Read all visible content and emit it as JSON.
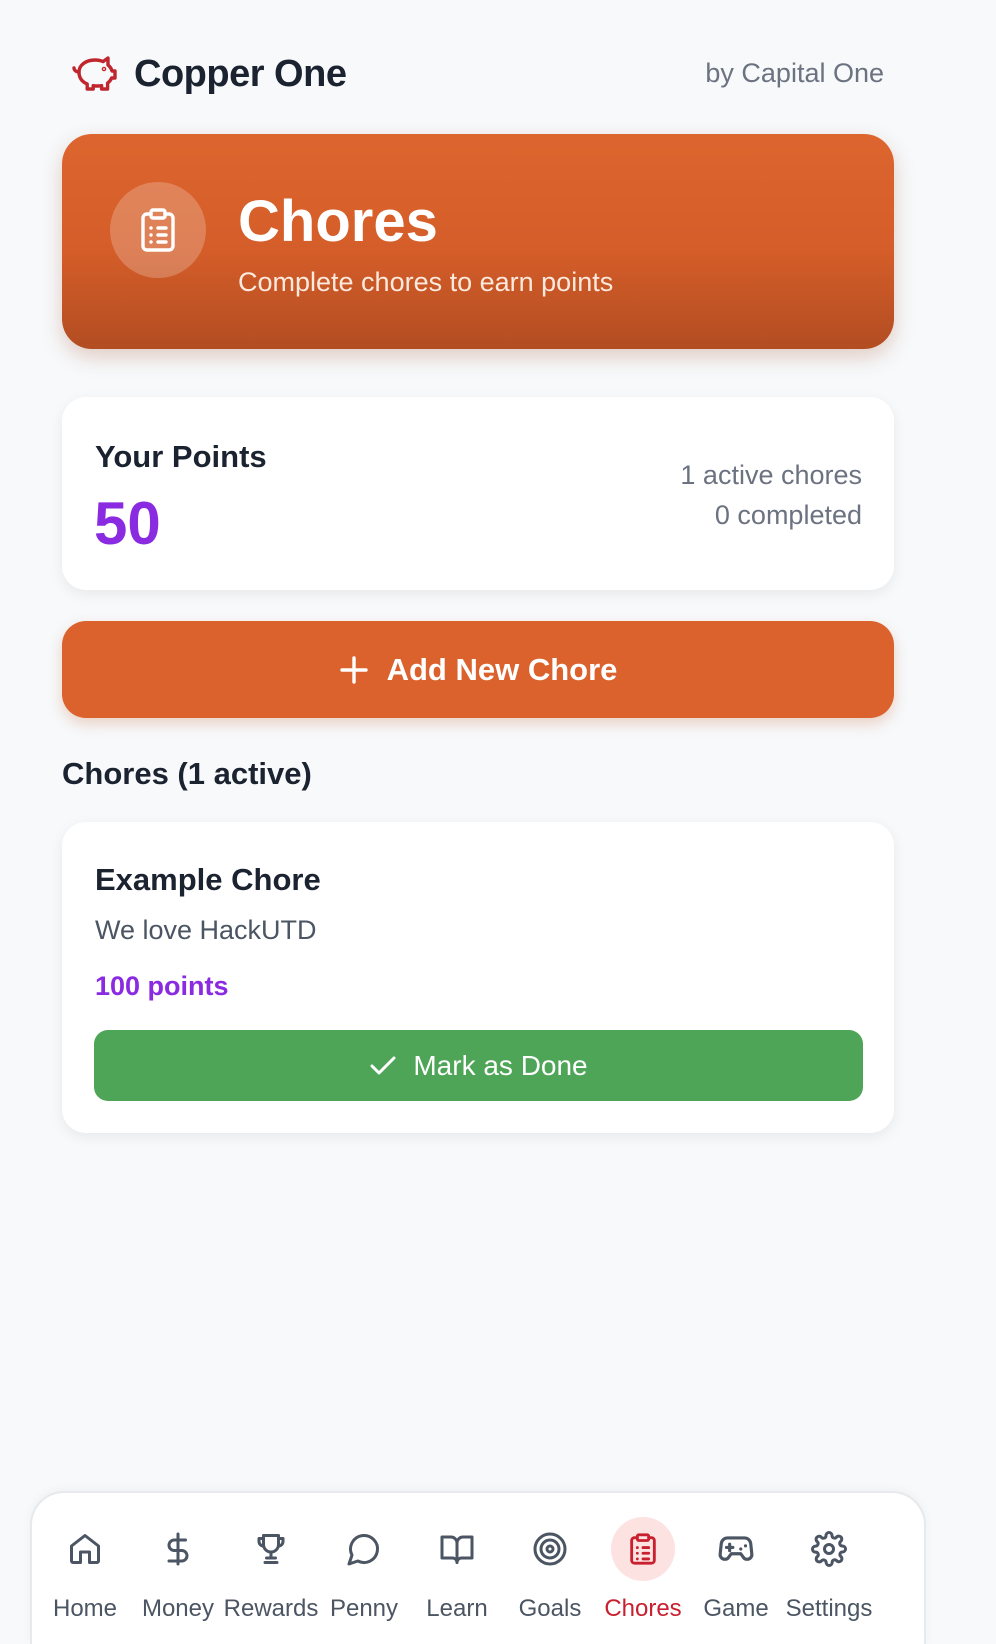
{
  "header": {
    "app_name": "Copper One",
    "by_line": "by Capital One"
  },
  "hero": {
    "title": "Chores",
    "subtitle": "Complete chores to earn points"
  },
  "points": {
    "label": "Your Points",
    "value": "50",
    "active_text": "1 active chores",
    "completed_text": "0 completed"
  },
  "add_button": {
    "label": "Add New Chore"
  },
  "chores_section": {
    "title": "Chores (1 active)",
    "items": [
      {
        "name": "Example Chore",
        "description": "We love HackUTD",
        "points": "100 points",
        "action_label": "Mark as Done"
      }
    ]
  },
  "bottom_nav": {
    "items": [
      {
        "label": "Home",
        "icon": "home-icon"
      },
      {
        "label": "Money",
        "icon": "dollar-icon"
      },
      {
        "label": "Rewards",
        "icon": "trophy-icon"
      },
      {
        "label": "Penny",
        "icon": "chat-bubble-icon"
      },
      {
        "label": "Learn",
        "icon": "book-icon"
      },
      {
        "label": "Goals",
        "icon": "target-icon"
      },
      {
        "label": "Chores",
        "icon": "clipboard-icon",
        "active": true
      },
      {
        "label": "Game",
        "icon": "gamepad-icon"
      },
      {
        "label": "Settings",
        "icon": "gear-icon"
      }
    ]
  },
  "colors": {
    "accent_orange": "#db622d",
    "points_purple": "#8a2be2",
    "done_green": "#4ea557",
    "active_nav_red": "#c8202f"
  }
}
